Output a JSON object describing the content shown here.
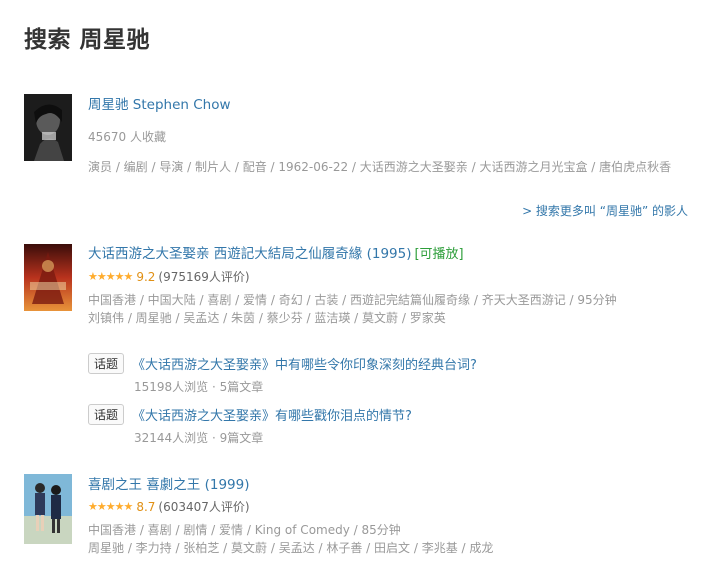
{
  "page": {
    "title": "搜索 周星驰"
  },
  "person": {
    "name": "周星驰 Stephen Chow",
    "favorites": "45670 人收藏",
    "details": "演员 / 编剧 / 导演 / 制片人 / 配音 / 1962-06-22 / 大话西游之大圣娶亲 / 大话西游之月光宝盒 / 唐伯虎点秋香",
    "more_link": "> 搜索更多叫 “周星驰” 的影人"
  },
  "movies": [
    {
      "title": "大话西游之大圣娶亲 西遊記大結局之仙履奇緣 (1995)",
      "playable": "[可播放]",
      "stars": "★★★★★",
      "rating": 9.2,
      "score": "9.2",
      "votes": "(975169人评价)",
      "meta": "中国香港 / 中国大陆 / 喜剧 / 爱情 / 奇幻 / 古装 / 西遊記完結篇仙履奇缘 / 齐天大圣西游记 / 95分钟",
      "cast": "刘镇伟 / 周星驰 / 吴孟达 / 朱茵 / 蔡少芬 / 蓝洁瑛 / 莫文蔚 / 罗家英"
    },
    {
      "title": "喜剧之王 喜劇之王 (1999)",
      "playable": "",
      "stars": "★★★★★",
      "rating": 8.7,
      "score": "8.7",
      "votes": "(603407人评价)",
      "meta": "中国香港 / 喜剧 / 剧情 / 爱情 / King of Comedy / 85分钟",
      "cast": "周星驰 / 李力持 / 张柏芝 / 莫文蔚 / 吴孟达 / 林子善 / 田启文 / 李兆基 / 成龙"
    }
  ],
  "topics": [
    {
      "tag": "话题",
      "title": "《大话西游之大圣娶亲》中有哪些令你印象深刻的经典台词?",
      "meta": "15198人浏览 · 5篇文章"
    },
    {
      "tag": "话题",
      "title": "《大话西游之大圣娶亲》有哪些戳你泪点的情节?",
      "meta": "32144人浏览 · 9篇文章"
    }
  ]
}
